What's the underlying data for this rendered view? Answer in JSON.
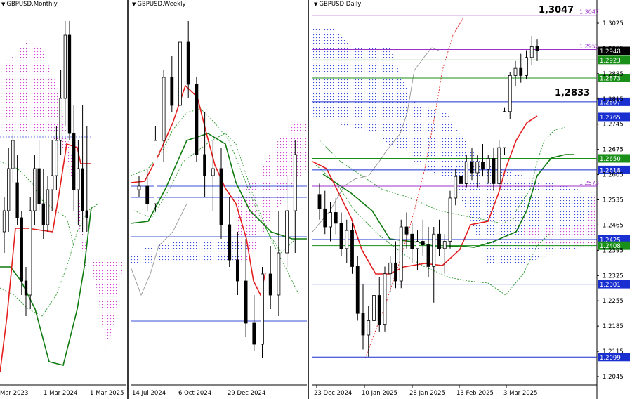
{
  "panels": [
    {
      "id": "p1",
      "title": "GBPUSD,Monthly",
      "xlabels": [
        "Mar 2023",
        "1 Mar 2024",
        "1 Mar 2025"
      ]
    },
    {
      "id": "p2",
      "title": "GBPUSD,Weekly",
      "xlabels": [
        "14 Jul 2024",
        "6 Oct 2024",
        "29 Dec 2024"
      ]
    },
    {
      "id": "p3",
      "title": "GBPUSD,Daily",
      "xlabels": [
        "23 Dec 2024",
        "10 Jan 2025",
        "28 Jan 2025",
        "13 Feb 2025",
        "3 Mar 2025"
      ]
    }
  ],
  "chart_data": {
    "type": "candlestick",
    "symbol": "GBPUSD",
    "timeframe": "Daily",
    "y_ticks": [
      "1.3025",
      "1.2955",
      "1.2885",
      "1.2815",
      "1.2745",
      "1.2675",
      "1.2605",
      "1.2535",
      "1.2465",
      "1.2395",
      "1.2325",
      "1.2255",
      "1.2185",
      "1.2115",
      "1.2045"
    ],
    "ylim": [
      1.2015,
      1.3075
    ],
    "annotations": {
      "high_label": "1,3047",
      "mid_label": "1,2833"
    },
    "levels": [
      {
        "price": 1.3047,
        "label": "1.3047",
        "color": "#9b30c8",
        "box": false
      },
      {
        "price": 1.2952,
        "label": "1.2952",
        "color": "#9b30c8",
        "box": false
      },
      {
        "price": 1.2948,
        "label": "1.2948",
        "color": "#000000",
        "box": true
      },
      {
        "price": 1.2923,
        "label": "1.2923",
        "color": "#1a8f1a",
        "box": true
      },
      {
        "price": 1.2873,
        "label": "1.2873",
        "color": "#1a8f1a",
        "box": true
      },
      {
        "price": 1.2807,
        "label": "1.2807",
        "color": "#1a2fd0",
        "box": true
      },
      {
        "price": 1.2765,
        "label": "1.2765",
        "color": "#1a2fd0",
        "box": true
      },
      {
        "price": 1.265,
        "label": "1.2650",
        "color": "#1a8f1a",
        "box": true
      },
      {
        "price": 1.2618,
        "label": "1.2618",
        "color": "#1a2fd0",
        "box": true
      },
      {
        "price": 1.2573,
        "label": "1.2573",
        "color": "#9b30c8",
        "box": false
      },
      {
        "price": 1.2425,
        "label": "1.2425",
        "color": "#1a2fd0",
        "box": true
      },
      {
        "price": 1.2408,
        "label": "1.2408",
        "color": "#1a8f1a",
        "box": true
      },
      {
        "price": 1.2301,
        "label": "1.2301",
        "color": "#1a2fd0",
        "box": true
      },
      {
        "price": 1.2099,
        "label": "1.2099",
        "color": "#1a2fd0",
        "box": true
      }
    ],
    "candles": [
      [
        1.255,
        1.258,
        1.248,
        1.251
      ],
      [
        1.251,
        1.256,
        1.244,
        1.246
      ],
      [
        1.246,
        1.253,
        1.242,
        1.25
      ],
      [
        1.25,
        1.254,
        1.244,
        1.247
      ],
      [
        1.247,
        1.25,
        1.238,
        1.24
      ],
      [
        1.24,
        1.248,
        1.236,
        1.245
      ],
      [
        1.245,
        1.247,
        1.233,
        1.235
      ],
      [
        1.235,
        1.238,
        1.22,
        1.222
      ],
      [
        1.222,
        1.23,
        1.212,
        1.216
      ],
      [
        1.216,
        1.224,
        1.21,
        1.22
      ],
      [
        1.22,
        1.229,
        1.216,
        1.227
      ],
      [
        1.227,
        1.232,
        1.217,
        1.219
      ],
      [
        1.219,
        1.235,
        1.217,
        1.233
      ],
      [
        1.233,
        1.238,
        1.228,
        1.236
      ],
      [
        1.236,
        1.242,
        1.229,
        1.231
      ],
      [
        1.231,
        1.248,
        1.229,
        1.246
      ],
      [
        1.246,
        1.25,
        1.24,
        1.244
      ],
      [
        1.244,
        1.247,
        1.236,
        1.24
      ],
      [
        1.24,
        1.245,
        1.234,
        1.242
      ],
      [
        1.242,
        1.248,
        1.238,
        1.241
      ],
      [
        1.241,
        1.246,
        1.232,
        1.235
      ],
      [
        1.235,
        1.246,
        1.225,
        1.244
      ],
      [
        1.244,
        1.248,
        1.238,
        1.24
      ],
      [
        1.24,
        1.244,
        1.233,
        1.242
      ],
      [
        1.242,
        1.256,
        1.24,
        1.254
      ],
      [
        1.254,
        1.262,
        1.252,
        1.26
      ],
      [
        1.26,
        1.264,
        1.256,
        1.258
      ],
      [
        1.258,
        1.266,
        1.257,
        1.264
      ],
      [
        1.264,
        1.268,
        1.259,
        1.261
      ],
      [
        1.261,
        1.266,
        1.257,
        1.264
      ],
      [
        1.264,
        1.269,
        1.26,
        1.262
      ],
      [
        1.262,
        1.266,
        1.258,
        1.265
      ],
      [
        1.265,
        1.268,
        1.256,
        1.258
      ],
      [
        1.258,
        1.27,
        1.257,
        1.268
      ],
      [
        1.268,
        1.279,
        1.266,
        1.278
      ],
      [
        1.278,
        1.289,
        1.276,
        1.288
      ],
      [
        1.288,
        1.292,
        1.285,
        1.29
      ],
      [
        1.29,
        1.294,
        1.286,
        1.288
      ],
      [
        1.288,
        1.295,
        1.287,
        1.293
      ],
      [
        1.293,
        1.299,
        1.291,
        1.296
      ],
      [
        1.296,
        1.298,
        1.292,
        1.2948
      ]
    ]
  }
}
